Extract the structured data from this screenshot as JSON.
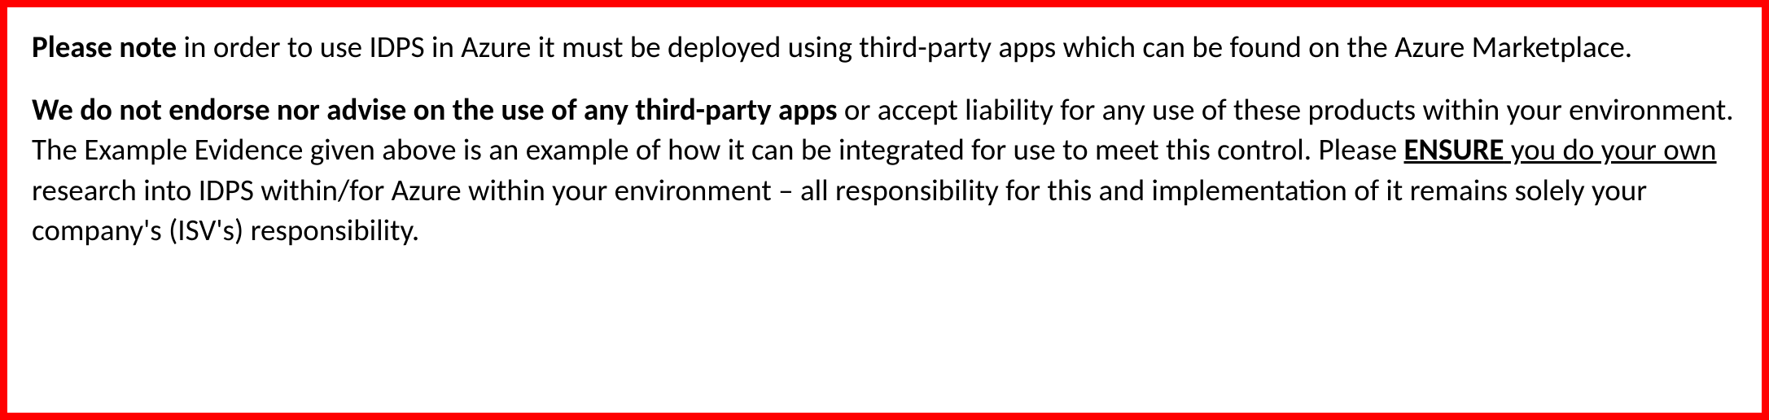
{
  "notice": {
    "p1": {
      "lead_bold": "Please note",
      "rest": " in order to use IDPS in Azure it must be deployed using third-party apps which can be found on the Azure Marketplace."
    },
    "p2": {
      "lead_bold": "We do not endorse nor advise on the use of any third-party apps",
      "part_a": " or accept liability for any use of these products within your environment. The Example Evidence given above is an example of how it can be integrated for use to meet this control. Please ",
      "ensure_bold_underline": "ENSURE",
      "ensure_underline_rest": " you do your own",
      "part_b": " research into IDPS within/for Azure within your environment – all responsibility for this and implementation of it remains solely your company's (ISV's) responsibility."
    }
  }
}
